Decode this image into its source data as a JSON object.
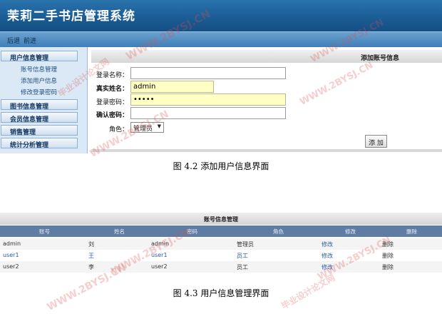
{
  "app": {
    "title": "茉莉二手书店管理系统"
  },
  "nav": {
    "back": "后退",
    "forward": "前进"
  },
  "sidebar": {
    "groups": [
      {
        "label": "用户信息管理",
        "items": [
          "账号信息管理",
          "添加用户信息",
          "修改登录密码"
        ]
      },
      {
        "label": "图书信息管理"
      },
      {
        "label": "会员信息管理"
      },
      {
        "label": "销售管理"
      },
      {
        "label": "统计分析管理"
      }
    ]
  },
  "form": {
    "caption": "添加账号信息",
    "fields": {
      "login_name": {
        "label": "登录名称：",
        "value": ""
      },
      "real_name": {
        "label": "真实姓名：",
        "value": "admin"
      },
      "password": {
        "label": "登录密码：",
        "value": "•••••"
      },
      "confirm": {
        "label": "确认密码：",
        "value": ""
      },
      "role": {
        "label": "角色：",
        "value": "管理员"
      }
    },
    "submit": "添 加"
  },
  "figure_captions": {
    "fig1": "图 4.2  添加用户信息界面",
    "fig2": "图 4.3  用户信息管理界面"
  },
  "table": {
    "caption": "账号信息管理",
    "columns": [
      "账号",
      "姓名",
      "密码",
      "角色",
      "修改",
      "删除"
    ],
    "rows": [
      {
        "account": "admin",
        "name": "刘",
        "password": "admin",
        "role": "管理员",
        "edit": "修改",
        "delete": "删除"
      },
      {
        "account": "user1",
        "name": "王",
        "password": "user1",
        "role": "员工",
        "edit": "修改",
        "delete": "删除"
      },
      {
        "account": "user2",
        "name": "李",
        "password": "user2",
        "role": "员工",
        "edit": "修改",
        "delete": "删除"
      }
    ]
  },
  "watermarks": {
    "site": "WWW.2BYSJ.CN",
    "cn": "毕业设计论文网"
  }
}
